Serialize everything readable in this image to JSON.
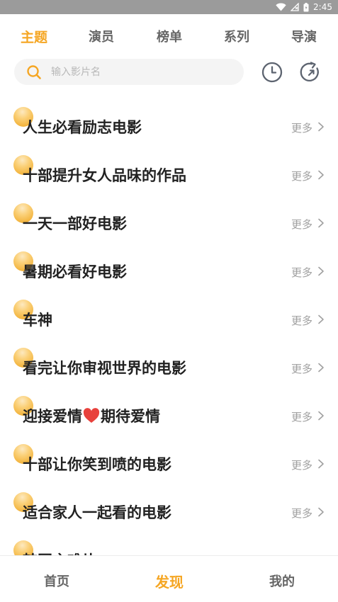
{
  "status_bar": {
    "time": "2:45"
  },
  "tabs": [
    "主题",
    "演员",
    "榜单",
    "系列",
    "导演"
  ],
  "search": {
    "placeholder": "输入影片名",
    "value": ""
  },
  "header_icons": {
    "history": "clock-icon",
    "share": "refresh-icon"
  },
  "list": {
    "more_label": "更多",
    "items": [
      {
        "title": "人生必看励志电影"
      },
      {
        "title": "十部提升女人品味的作品"
      },
      {
        "title": "一天一部好电影"
      },
      {
        "title": "暑期必看好电影"
      },
      {
        "title": "车神"
      },
      {
        "title": "看完让你审视世界的电影"
      },
      {
        "title_before": "迎接爱情",
        "title_after": "期待爱情"
      },
      {
        "title": "十部让你笑到喷的电影"
      },
      {
        "title": "适合家人一起看的电影"
      },
      {
        "title": "韩国灾难片"
      }
    ]
  },
  "bottom_nav": [
    "首页",
    "发现",
    "我的"
  ],
  "colors": {
    "accent": "#f5a623",
    "heart": "#e8413c"
  }
}
